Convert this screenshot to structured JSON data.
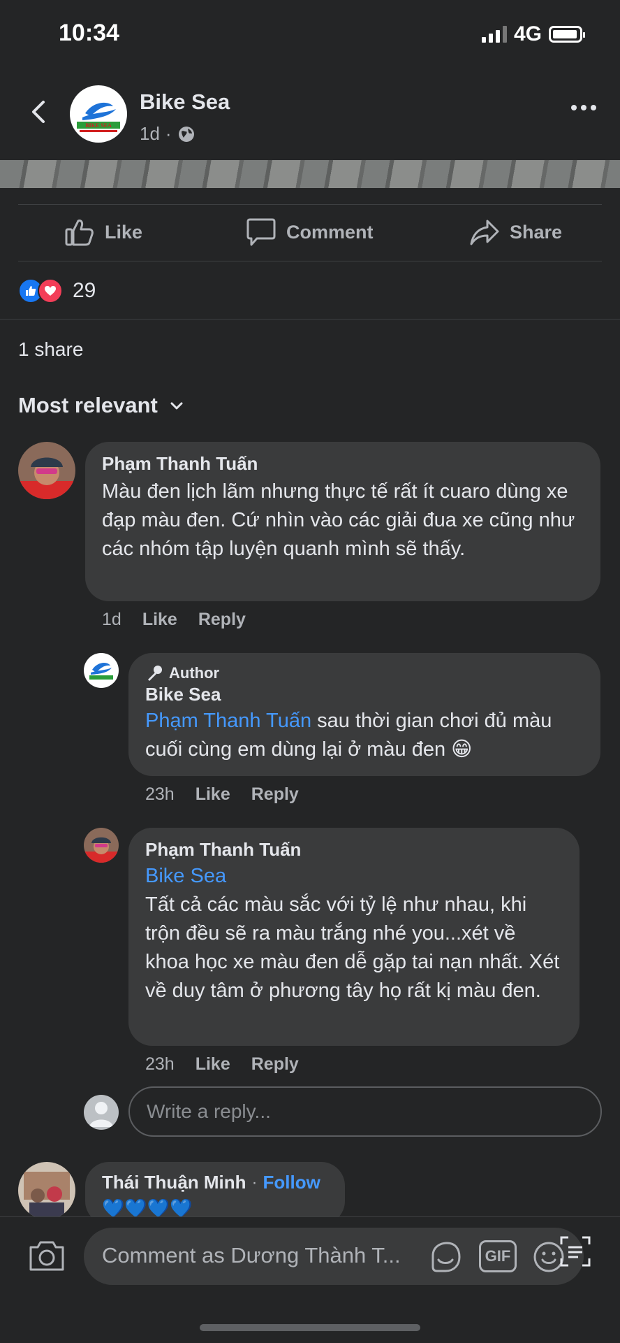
{
  "status_bar": {
    "time": "10:34",
    "network": "4G"
  },
  "post": {
    "page_name": "Bike Sea",
    "avatar_text": "BIKE SEA",
    "time": "1d",
    "separator": "·",
    "actions": {
      "like": "Like",
      "comment": "Comment",
      "share": "Share"
    },
    "reaction_count": "29",
    "share_count": "1 share",
    "sort_label": "Most relevant"
  },
  "comments": [
    {
      "author": "Phạm Thanh Tuấn",
      "text": "Màu đen lịch lãm nhưng thực tế rất ít cuaro dùng xe đạp màu đen. Cứ nhìn vào các giải đua xe cũng như các nhóm tập luyện quanh mình sẽ thấy.",
      "time": "1d",
      "like": "Like",
      "reply": "Reply"
    },
    {
      "badge": "Author",
      "author": "Bike Sea",
      "mention": "Phạm Thanh Tuấn",
      "text": " sau thời gian chơi đủ màu cuối cùng em dùng lại ở màu đen 😁",
      "time": "23h",
      "like": "Like",
      "reply": "Reply"
    },
    {
      "author": "Phạm Thanh Tuấn",
      "mention": "Bike Sea",
      "text": "Tất cả các màu sắc với tỷ lệ như nhau, khi trộn đều sẽ ra màu trắng nhé you...xét về khoa học xe màu đen dễ gặp tai nạn nhất. Xét về duy tâm ở phương tây họ rất kị màu đen.",
      "time": "23h",
      "like": "Like",
      "reply": "Reply"
    },
    {
      "author": "Thái Thuận Minh",
      "follow": "Follow",
      "separator": "·",
      "text": "💙💙💙💙"
    }
  ],
  "reply_placeholder": "Write a reply...",
  "bottom": {
    "comment_placeholder": "Comment as Dương Thành T...",
    "gif_label": "GIF"
  },
  "colors": {
    "background": "#242526",
    "bubble": "#3a3b3c",
    "link": "#4599ff",
    "like_blue": "#1877f2",
    "love_red": "#f33e58"
  }
}
